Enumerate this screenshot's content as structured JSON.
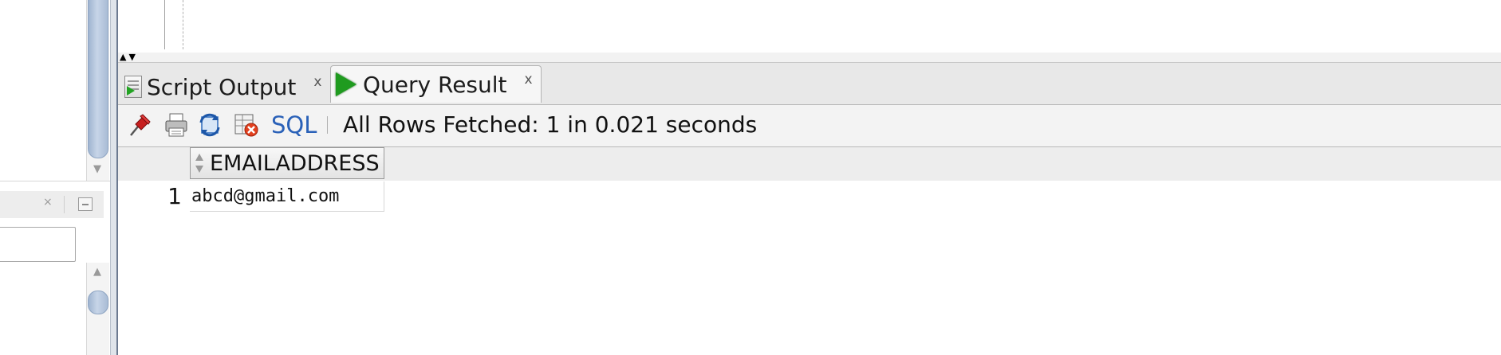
{
  "left_panel": {
    "close_glyph": "×",
    "scroll_down_glyph": "▼",
    "scroll_up_glyph": "▲"
  },
  "split_arrows": "▲▼",
  "tabs": [
    {
      "label": "Script Output",
      "close": "x",
      "icon": "script-doc-icon",
      "active": false
    },
    {
      "label": "Query Result",
      "close": "x",
      "icon": "run-play-icon",
      "active": true
    }
  ],
  "toolbar": {
    "icons": [
      "pin-icon",
      "print-icon",
      "refresh-icon",
      "cancel-query-icon"
    ],
    "sql_label": "SQL",
    "status": "All Rows Fetched: 1 in 0.021 seconds"
  },
  "grid": {
    "columns": [
      "EMAILADDRESS"
    ],
    "rows": [
      {
        "num": "1",
        "cells": [
          "abcd@gmail.com"
        ]
      }
    ]
  },
  "colors": {
    "play": "#1f9b1f",
    "sql_link": "#2a61b8",
    "scroll_thumb": "#c7d5e8"
  }
}
